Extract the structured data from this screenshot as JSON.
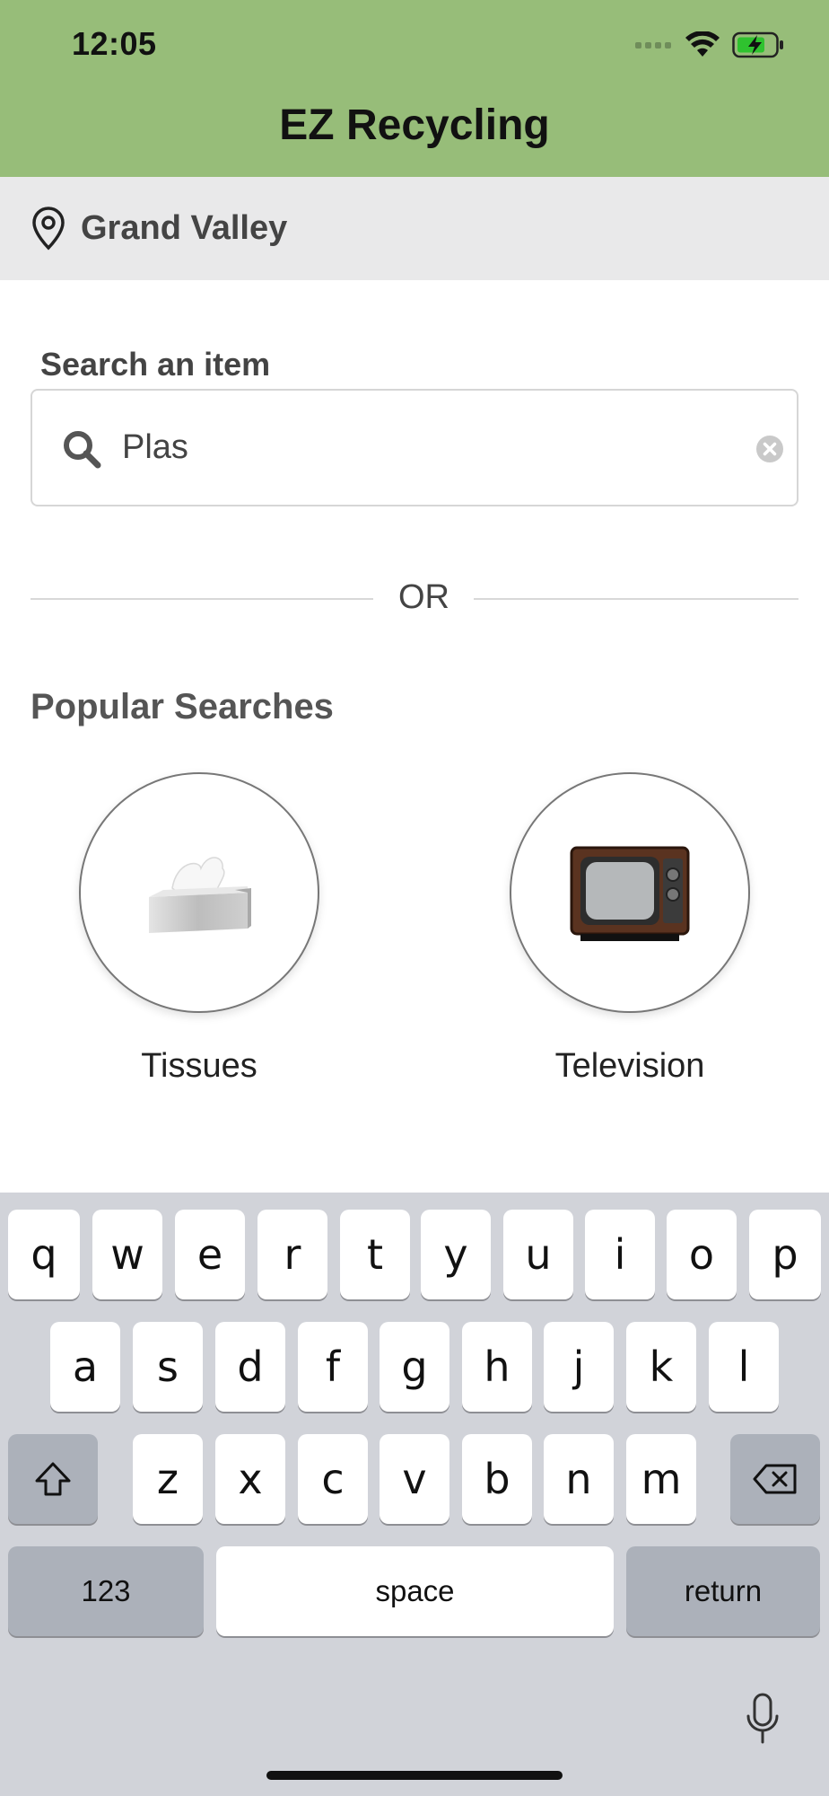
{
  "status_bar": {
    "time": "12:05"
  },
  "header": {
    "title": "EZ Recycling",
    "color": "#97bd79"
  },
  "location": {
    "name": "Grand Valley"
  },
  "search": {
    "label": "Search an item",
    "value": "Plas",
    "placeholder": ""
  },
  "divider": {
    "text": "OR"
  },
  "popular": {
    "title": "Popular Searches",
    "items": [
      {
        "label": "Tissues",
        "icon": "tissue-box-icon"
      },
      {
        "label": "Television",
        "icon": "television-icon"
      }
    ]
  },
  "keyboard": {
    "row1": [
      "q",
      "w",
      "e",
      "r",
      "t",
      "y",
      "u",
      "i",
      "o",
      "p"
    ],
    "row2": [
      "a",
      "s",
      "d",
      "f",
      "g",
      "h",
      "j",
      "k",
      "l"
    ],
    "row3": [
      "z",
      "x",
      "c",
      "v",
      "b",
      "n",
      "m"
    ],
    "numbers_label": "123",
    "space_label": "space",
    "return_label": "return"
  }
}
